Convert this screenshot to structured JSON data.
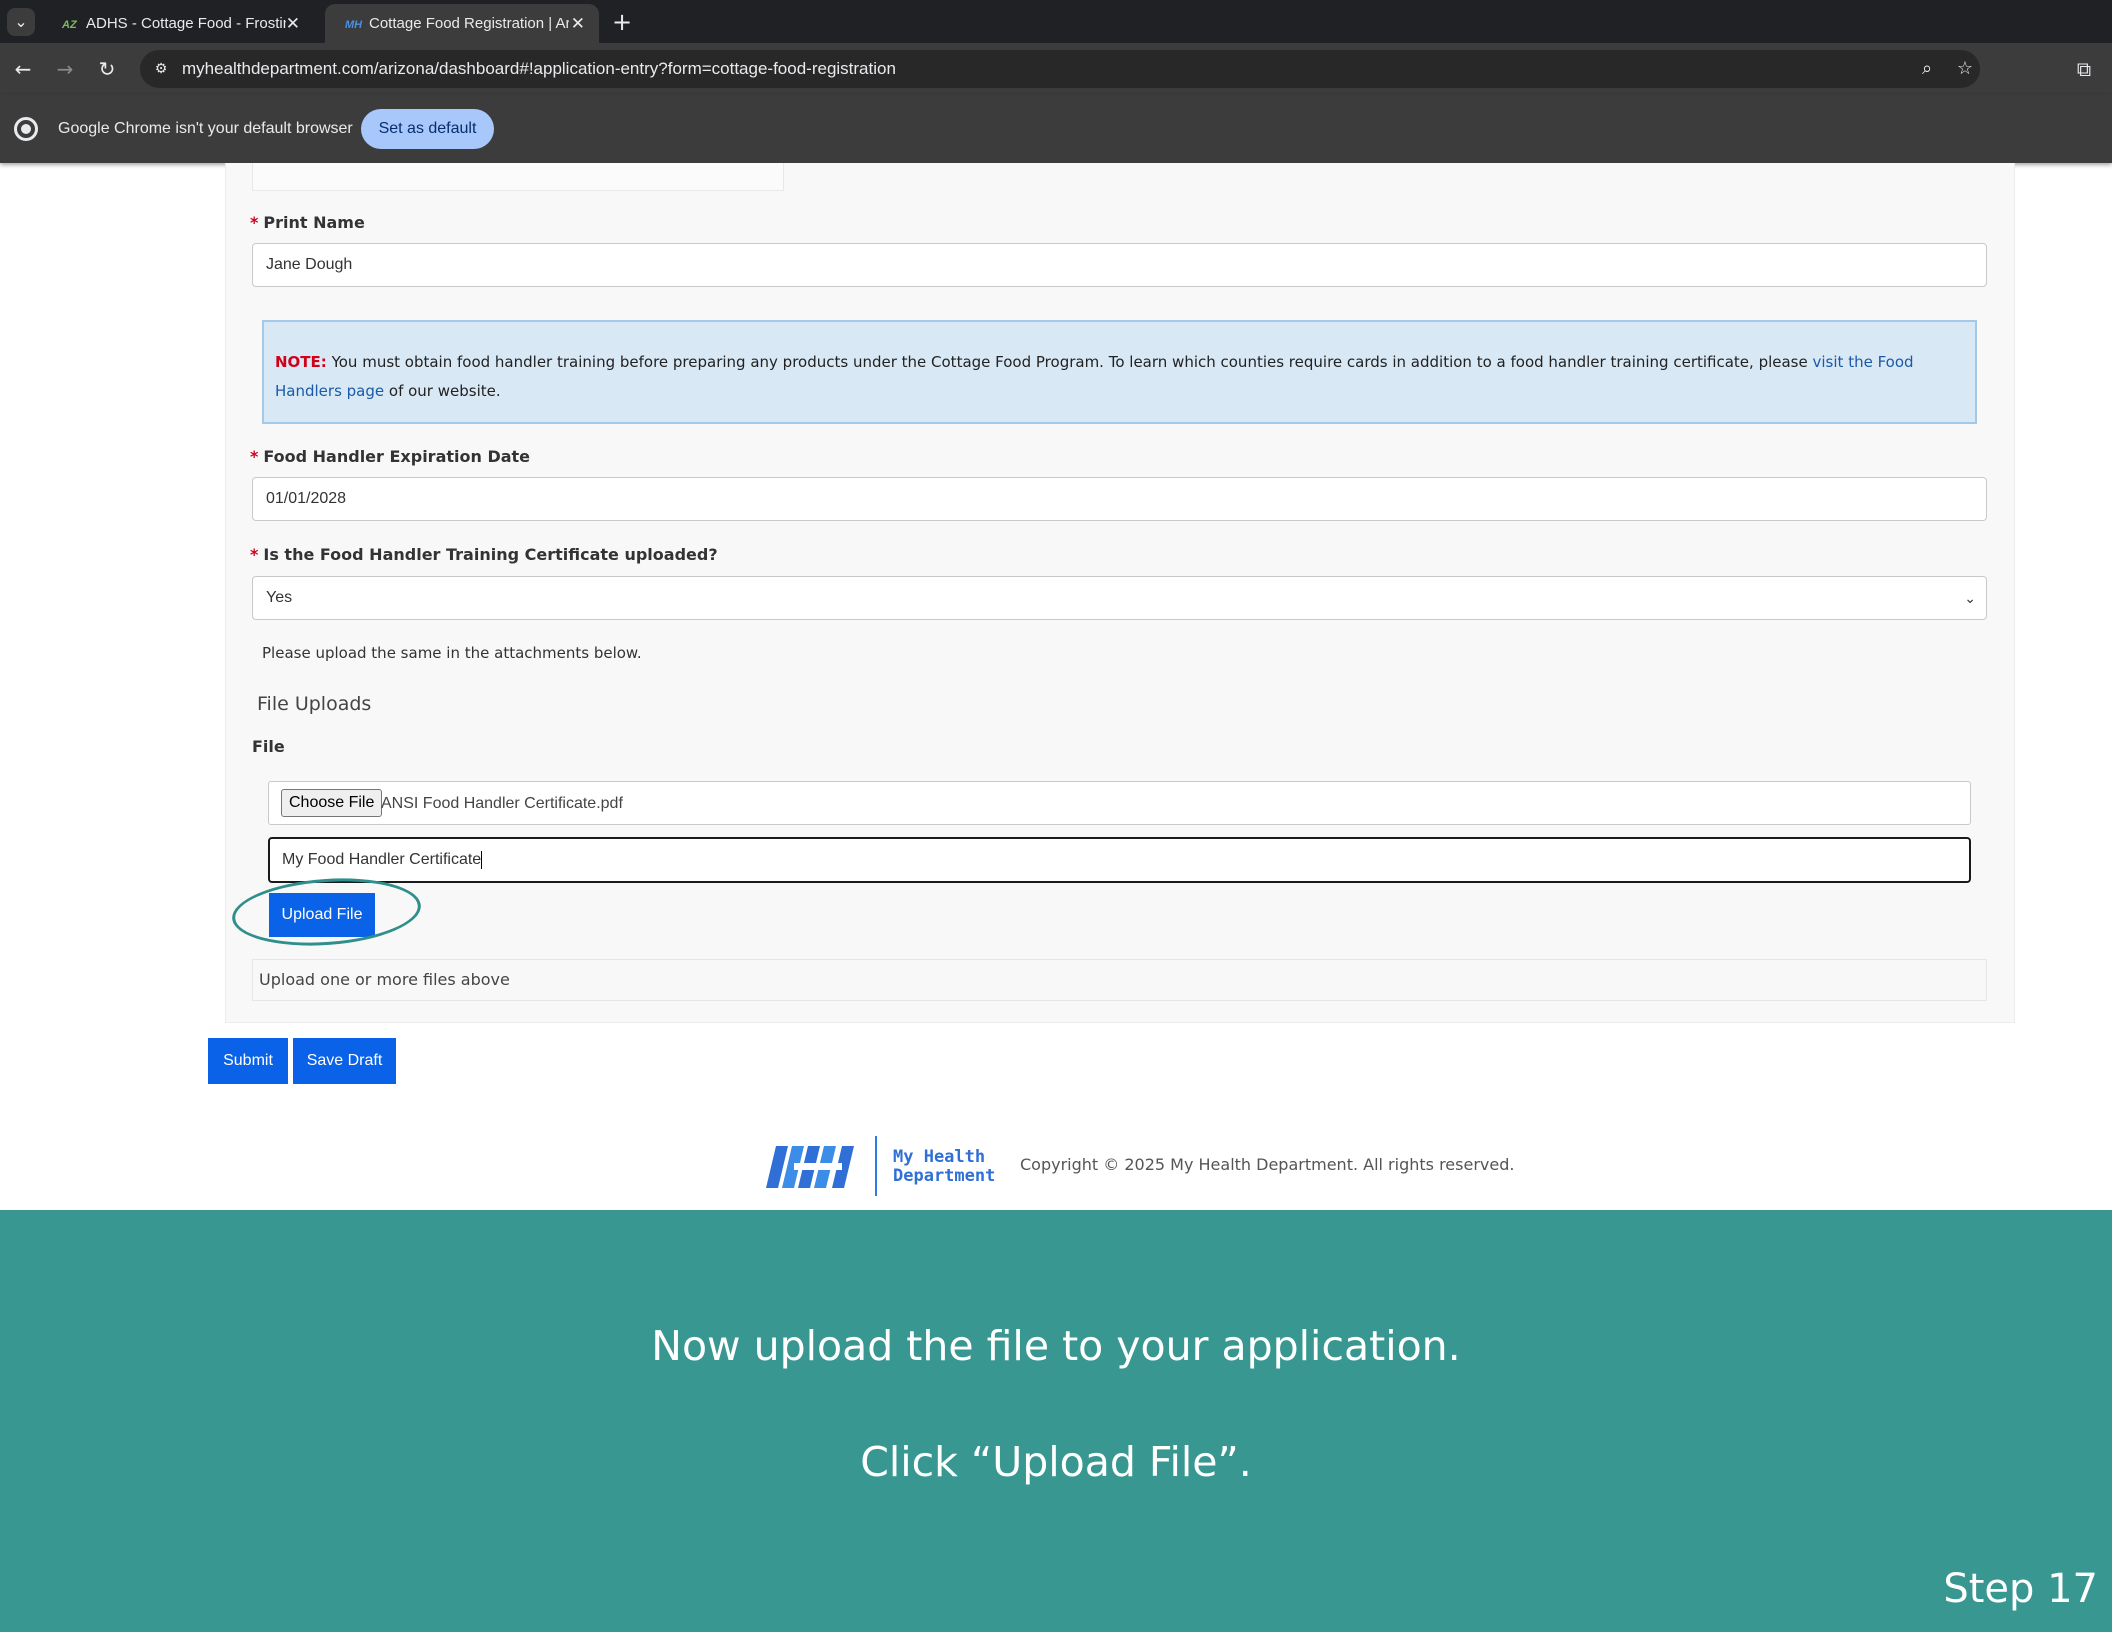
{
  "browser": {
    "tabs": [
      {
        "title": "ADHS - Cottage Food - Frosting",
        "active": false
      },
      {
        "title": "Cottage Food Registration | Arizona",
        "active": true
      }
    ],
    "url": "myhealthdepartment.com/arizona/dashboard#!application-entry?form=cottage-food-registration",
    "infobar": {
      "message": "Google Chrome isn't your default browser",
      "button": "Set as default"
    }
  },
  "form": {
    "print_name": {
      "label": "Print Name",
      "value": "Jane Dough"
    },
    "note": {
      "label": "NOTE:",
      "text": "You must obtain food handler training before preparing any products under the Cottage Food Program. To learn which counties require cards in addition to a food handler training certificate, please",
      "link": "visit the Food Handlers page",
      "suffix": "of our website."
    },
    "expiration": {
      "label": "Food Handler Expiration Date",
      "value": "01/01/2028"
    },
    "certificate_uploaded": {
      "label": "Is the Food Handler Training Certificate uploaded?",
      "value": "Yes"
    },
    "helper_text": "Please upload the same in the attachments below.",
    "uploads": {
      "section_title": "File Uploads",
      "file_label": "File",
      "choose_button": "Choose File",
      "file_name": "ANSI Food Handler Certificate.pdf",
      "description": "My Food Handler Certificate",
      "upload_button": "Upload File",
      "empty_message": "Upload one or more files above"
    },
    "submit_button": "Submit",
    "save_draft_button": "Save Draft"
  },
  "footer": {
    "brand": "My Health Department",
    "brand_line1": "My Health",
    "brand_line2": "Department",
    "copyright": "Copyright © 2025 My Health Department. All rights reserved."
  },
  "tutorial": {
    "line1": "Now upload the file to your application.",
    "line2": "Click “Upload File”.",
    "step": "Step 17"
  },
  "colors": {
    "primary_button": "#0a62e8",
    "banner": "#389891",
    "highlight_ring": "#2f8f8c",
    "required": "#d0021b"
  }
}
